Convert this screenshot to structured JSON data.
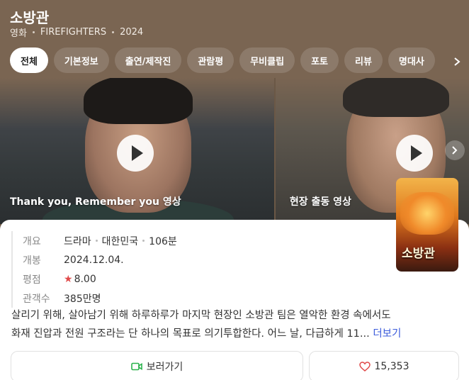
{
  "header": {
    "title": "소방관",
    "category": "영화",
    "english_title": "FIREFIGHTERS",
    "year": "2024"
  },
  "tabs": [
    {
      "label": "전체",
      "active": true
    },
    {
      "label": "기본정보",
      "active": false
    },
    {
      "label": "출연/제작진",
      "active": false
    },
    {
      "label": "관람평",
      "active": false
    },
    {
      "label": "무비클립",
      "active": false
    },
    {
      "label": "포토",
      "active": false
    },
    {
      "label": "리뷰",
      "active": false
    },
    {
      "label": "명대사",
      "active": false
    }
  ],
  "videos": [
    {
      "label": "Thank you, Remember you 영상"
    },
    {
      "label": "현장 출동 영상"
    }
  ],
  "info": {
    "overview_label": "개요",
    "genre": "드라마",
    "country": "대한민국",
    "runtime": "106분",
    "release_label": "개봉",
    "release_date": "2024.12.04.",
    "rating_label": "평점",
    "rating_star": "★",
    "rating": "8.00",
    "audience_label": "관객수",
    "audience": "385만명"
  },
  "poster": {
    "title": "소방관"
  },
  "synopsis": {
    "line1": "살리기 위해, 살아남기 위해 하루하루가 마지막 현장인 소방관 팀은 열악한 환경 속에서도",
    "line2": "화재 진압과 전원 구조라는 단 하나의 목표로 의기투합한다. 어느 날, 다급하게 11...",
    "more": "더보기"
  },
  "actions": {
    "watch_label": "보러가기",
    "like_count": "15,353"
  },
  "colors": {
    "header_bg": "#7a6552",
    "accent_link": "#3b5bdb",
    "star": "#e04a4a",
    "watch_icon": "#2bb24c",
    "heart_icon": "#e04a4a"
  }
}
